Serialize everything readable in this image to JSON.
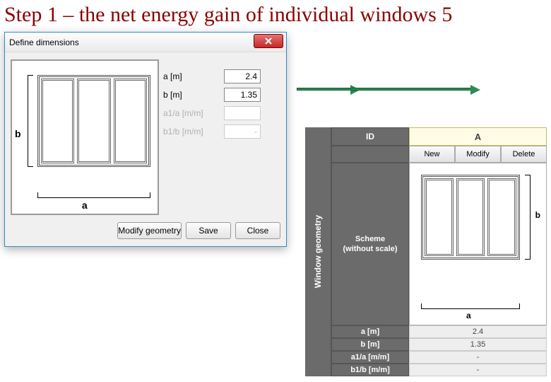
{
  "slide": {
    "title": "Step 1 – the net energy gain of individual windows 5"
  },
  "dialog": {
    "title": "Define dimensions",
    "fields": {
      "a": {
        "label": "a [m]",
        "value": "2.4"
      },
      "b": {
        "label": "b [m]",
        "value": "1.35"
      },
      "a1a": {
        "label": "a1/a [m/m]",
        "value": ""
      },
      "b1b": {
        "label": "b1/b [m/m]",
        "value": "-"
      }
    },
    "labels": {
      "a": "a",
      "b": "b"
    },
    "buttons": {
      "modify": "Modify geometry",
      "save": "Save",
      "close": "Close"
    }
  },
  "panel": {
    "side_title": "Window geometry",
    "id_label": "ID",
    "id_value": "A",
    "buttons": {
      "new": "New",
      "modify": "Modify",
      "delete": "Delete"
    },
    "scheme": {
      "label": "Scheme",
      "sub": "(without scale)",
      "a": "a",
      "b": "b"
    },
    "rows": {
      "a": {
        "label": "a [m]",
        "value": "2.4"
      },
      "b": {
        "label": "b [m]",
        "value": "1.35"
      },
      "a1a": {
        "label": "a1/a [m/m]",
        "value": "-"
      },
      "b1b": {
        "label": "b1/b [m/m]",
        "value": "-"
      }
    }
  }
}
